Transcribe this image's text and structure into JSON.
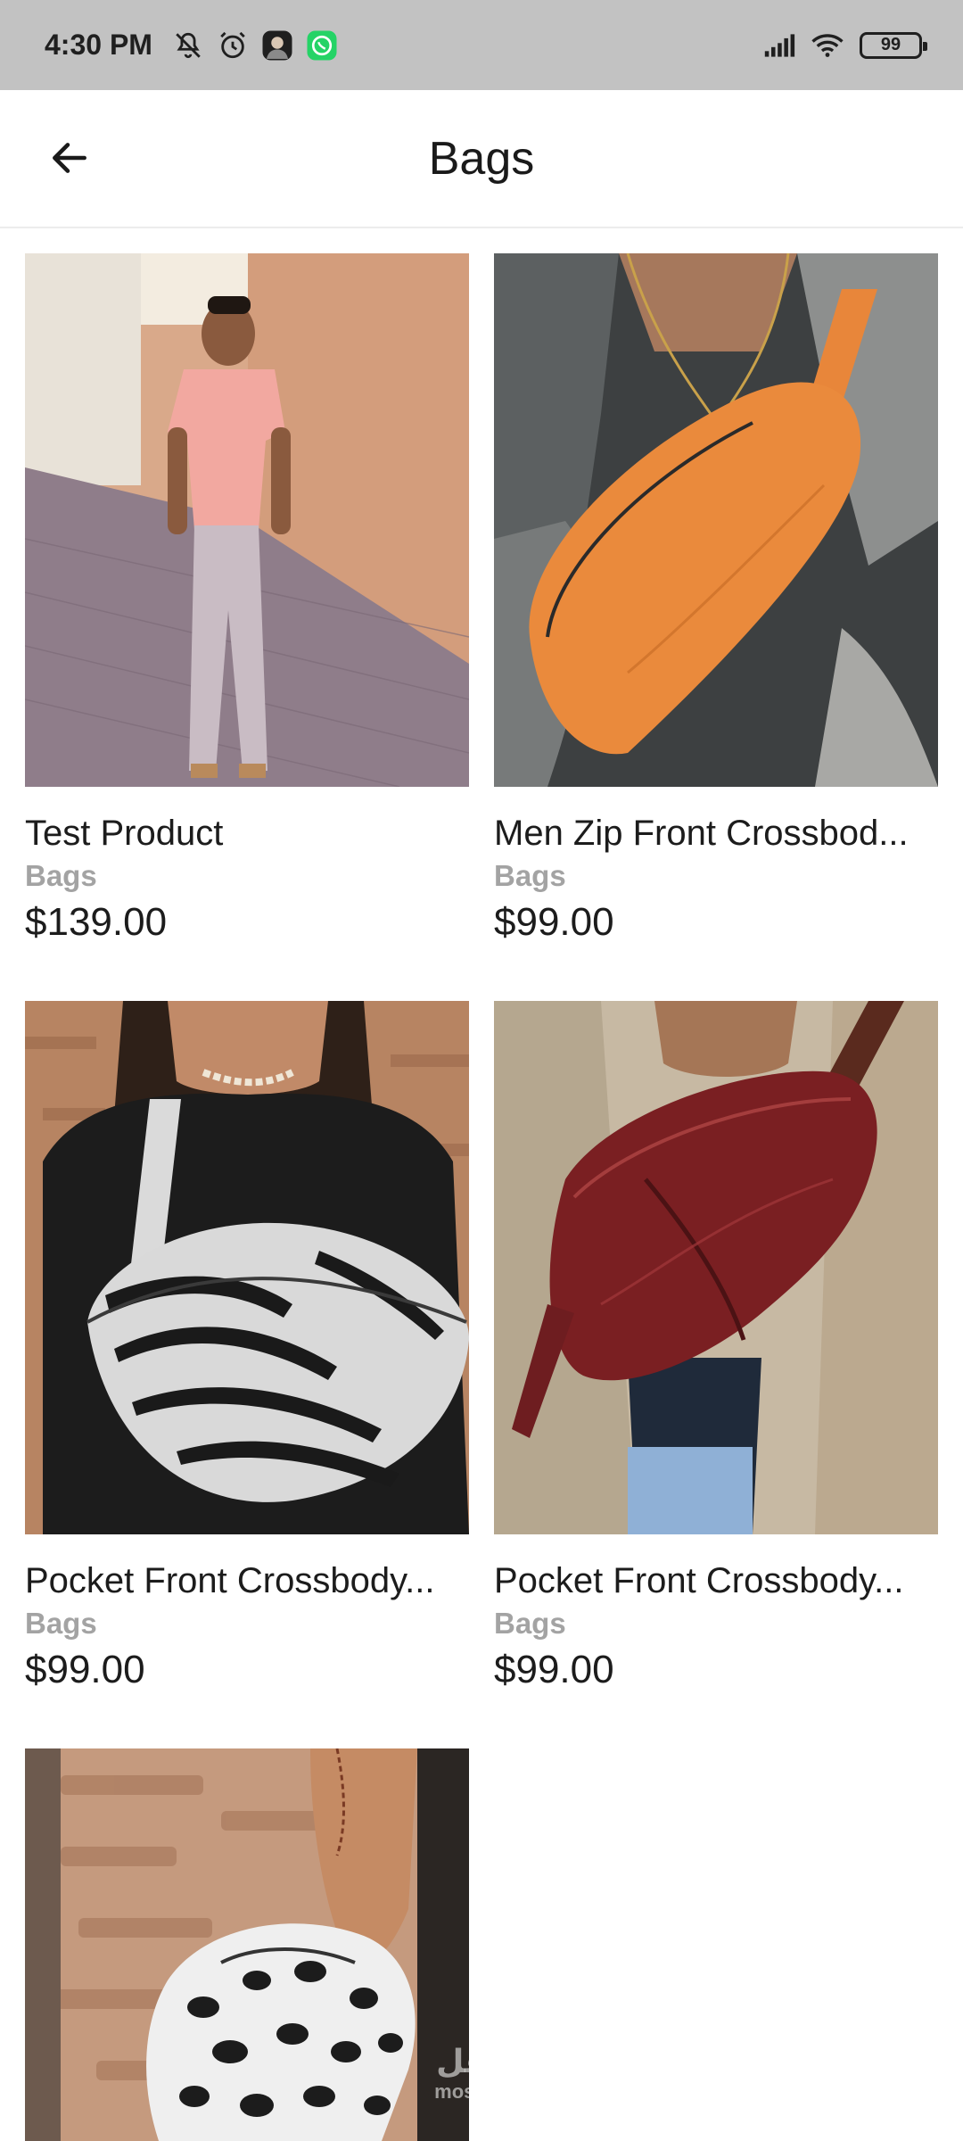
{
  "status_bar": {
    "time": "4:30 PM",
    "battery": "99",
    "icons": [
      "mute-icon",
      "alarm-icon",
      "avatar-notification-icon",
      "whatsapp-icon",
      "signal-icon",
      "wifi-icon",
      "battery-icon"
    ]
  },
  "app_bar": {
    "title": "Bags",
    "back_icon": "arrow-left-icon"
  },
  "products": [
    {
      "name": "Test Product",
      "category": "Bags",
      "price": "$139.00"
    },
    {
      "name": "Men Zip Front Crossbod...",
      "category": "Bags",
      "price": "$99.00"
    },
    {
      "name": "Pocket Front Crossbody...",
      "category": "Bags",
      "price": "$99.00"
    },
    {
      "name": "Pocket Front Crossbody...",
      "category": "Bags",
      "price": "$99.00"
    },
    {
      "name": "",
      "category": "",
      "price": ""
    }
  ],
  "watermark": {
    "arabic": "مستقل",
    "latin": "mostaql.com"
  },
  "colors": {
    "status_bar_bg": "#c2c2c2",
    "whatsapp": "#25d366",
    "category_text": "#a3a3a3"
  }
}
